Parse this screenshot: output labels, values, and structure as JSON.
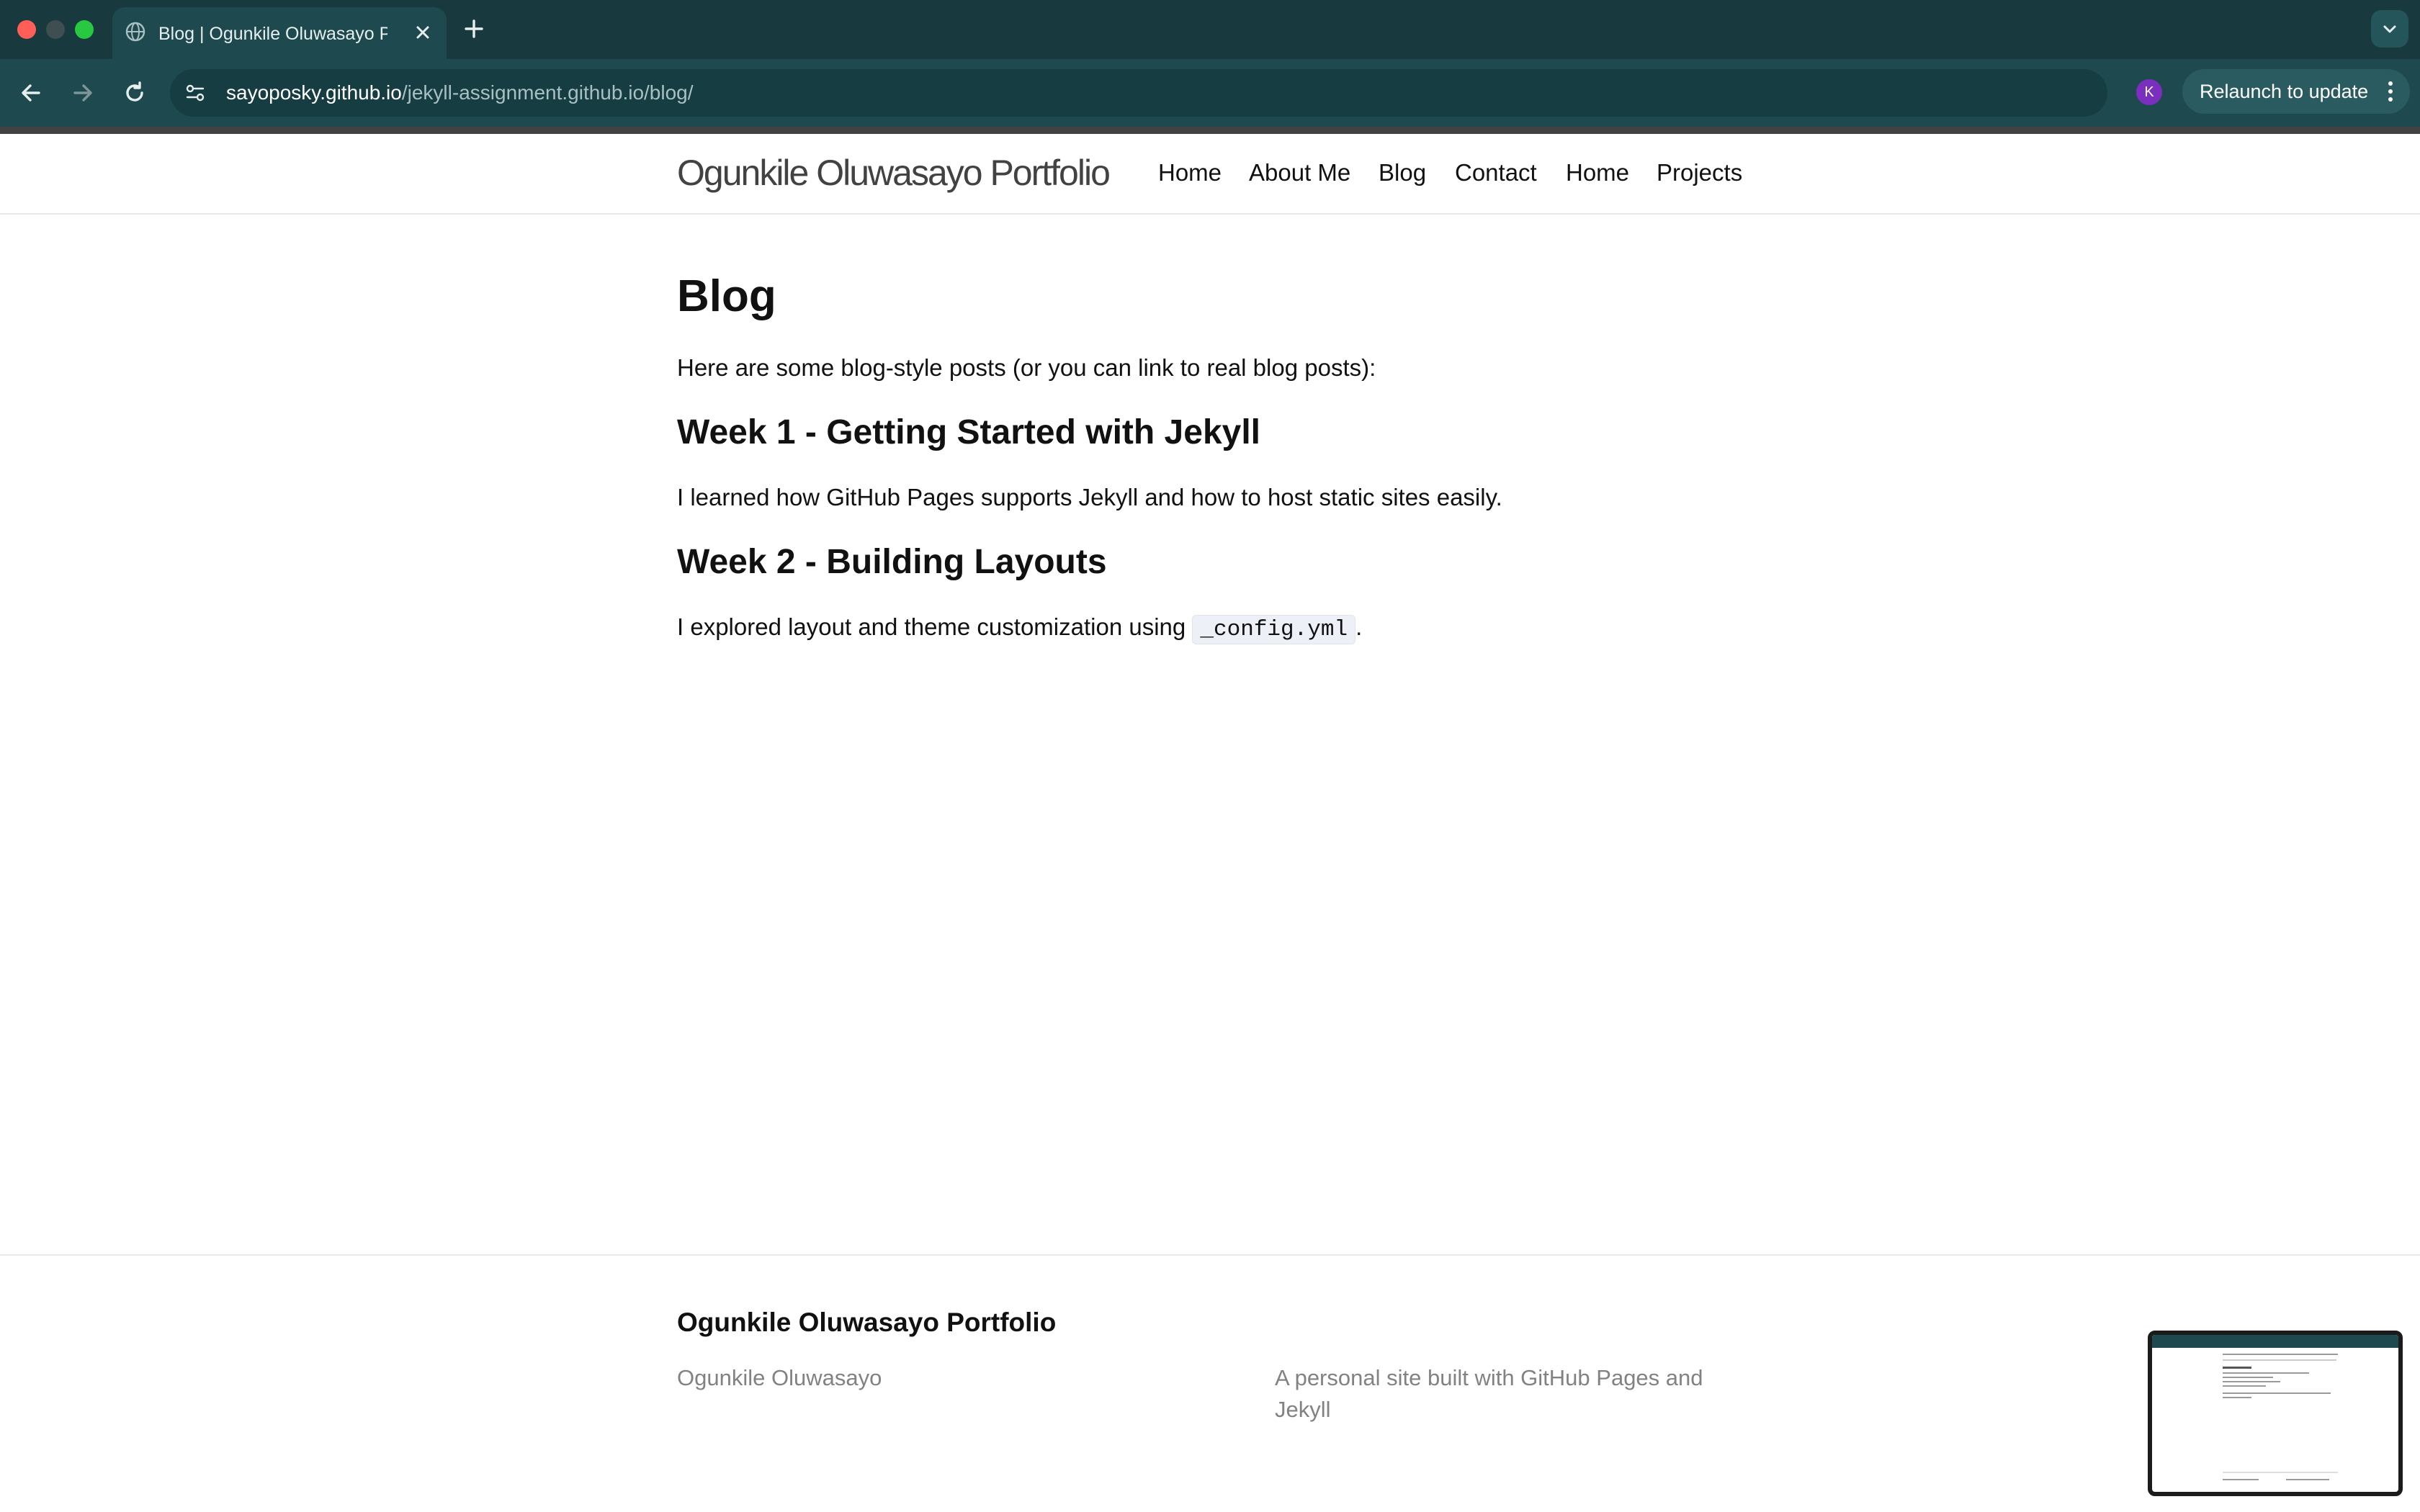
{
  "browser": {
    "tab_title": "Blog | Ogunkile Oluwasayo Portfolio",
    "url_host": "sayoposky.github.io",
    "url_path": "/jekyll-assignment.github.io/blog/",
    "profile_initial": "K",
    "relaunch_label": "Relaunch to update"
  },
  "site": {
    "title": "Ogunkile Oluwasayo Portfolio",
    "nav": [
      "Home",
      "About Me",
      "Blog",
      "Contact",
      "Home",
      "Projects"
    ]
  },
  "content": {
    "heading": "Blog",
    "intro": "Here are some blog-style posts (or you can link to real blog posts):",
    "posts": [
      {
        "title": "Week 1 - Getting Started with Jekyll",
        "body": "I learned how GitHub Pages supports Jekyll and how to host static sites easily."
      },
      {
        "title": "Week 2 - Building Layouts",
        "body_before": "I explored layout and theme customization using ",
        "code": "_config.yml",
        "body_after": "."
      }
    ]
  },
  "footer": {
    "title": "Ogunkile Oluwasayo Portfolio",
    "author": "Ogunkile Oluwasayo",
    "description": "A personal site built with GitHub Pages and Jekyll"
  },
  "colors": {
    "chrome_bg": "#183a3e",
    "toolbar_bg": "#1e4a4f",
    "avatar": "#7b2fbf",
    "text": "#111111",
    "muted": "#828282"
  }
}
